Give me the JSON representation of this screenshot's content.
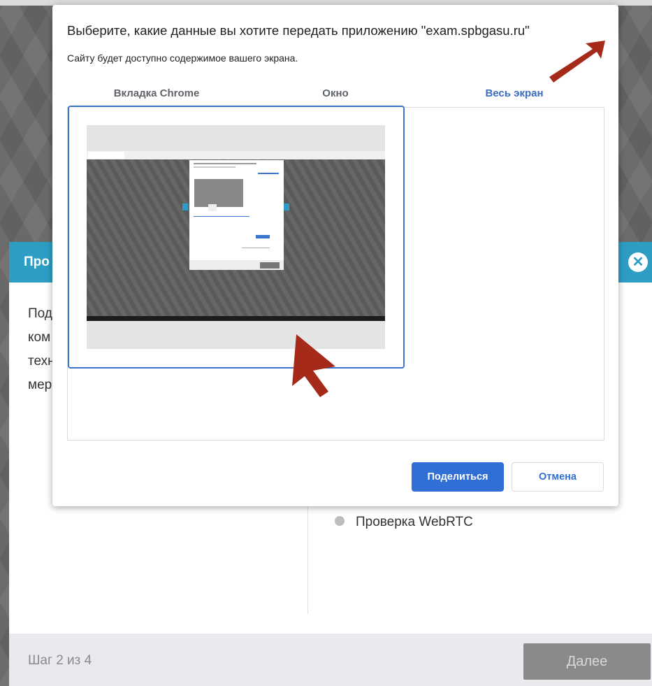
{
  "background_modal": {
    "title": "Про",
    "body_lines": [
      "Под",
      "ком",
      "техн",
      "мер"
    ],
    "check_item": "Проверка WebRTC",
    "step_text": "Шаг 2 из 4",
    "next_label": "Далее"
  },
  "share_dialog": {
    "title": "Выберите, какие данные вы хотите передать приложению \"exam.spbgasu.ru\"",
    "subtitle": "Сайту будет доступно содержимое вашего экрана.",
    "tabs": [
      {
        "label": "Вкладка Chrome",
        "active": false
      },
      {
        "label": "Окно",
        "active": false
      },
      {
        "label": "Весь экран",
        "active": true
      }
    ],
    "share_label": "Поделиться",
    "cancel_label": "Отмена"
  },
  "colors": {
    "accent_blue": "#2f6fd6",
    "header_teal": "#2d9dc4",
    "arrow_red": "#a52a1a"
  }
}
